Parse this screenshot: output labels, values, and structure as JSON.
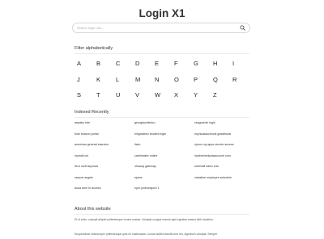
{
  "header": {
    "title": "Login X1",
    "search_placeholder": "Search login urls..."
  },
  "filter": {
    "heading": "Filter alphabetically",
    "letters": [
      "A",
      "B",
      "C",
      "D",
      "E",
      "F",
      "G",
      "H",
      "I",
      "J",
      "K",
      "L",
      "M",
      "N",
      "O",
      "P",
      "Q",
      "R",
      "S",
      "T",
      "U",
      "V",
      "W",
      "X",
      "Y",
      "Z"
    ]
  },
  "recent": {
    "heading": "Indexed Recently",
    "links": [
      "aswaks tote",
      "georgiaunitedcu",
      "csaguchek login",
      "blue beacon portal",
      "eingradeev student login",
      "myvsuaiaschools gradebook",
      "american general esarvice",
      "lisdu",
      "ujnmc my apps remote access",
      "mymail uni",
      "carelmaker online",
      "mytimehedpotsaccount com",
      "fleur stuff skyward",
      "nhsway gateway",
      "webmail edmc edu",
      "ranport angeln",
      "ejams",
      "valvaline employee schedule",
      "aooa ahm hr access",
      "epro protransport 1",
      ""
    ]
  },
  "about": {
    "heading": "About this website",
    "paragraph1": "Et ut enim, suscipit aliquet pellentesque ornare massa. Volutpat congue mauris eget egestas massa nibh faucibus.",
    "paragraph2": "Suspendisse ullamcorper pellentesque quis mi malesuada. Luctus facilisi blandit urna leo, dignissim volutpat. Semper"
  }
}
